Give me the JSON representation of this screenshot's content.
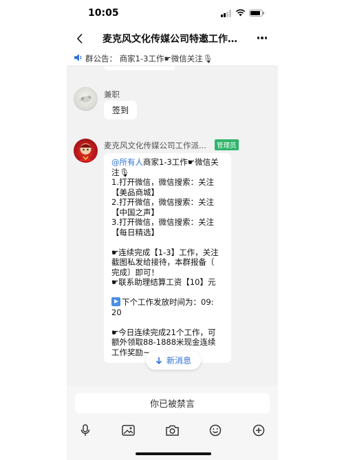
{
  "status_bar": {
    "time": "10:05",
    "battery_level": 0.9
  },
  "header": {
    "title": "麦克风文化传媒公司特邀工作...",
    "back_icon": "chevron-left-icon",
    "more_icon": "more-dots-icon"
  },
  "notice": {
    "label": "群公告：",
    "text": "商家1-3工作☛微信关注🎙",
    "icon": "megaphone-icon"
  },
  "messages": [
    {
      "sender": "兼职",
      "text": "签到"
    },
    {
      "sender": "麦克风文化传媒公司工作派...",
      "badge": "管理员",
      "mention": "@所有人",
      "lines": [
        "商家1-3工作☛微信关",
        "注🎙",
        "1.打开微信，微信搜索：关注",
        "【美品商城】",
        "2.打开微信，微信搜索：关注",
        "【中国之声】",
        "3.打开微信，微信搜索：关注",
        "【每日精选】",
        "",
        "☛连续完成【1-3】工作，关注",
        "截图私发给接待，本群报备〔",
        "完成〕即可！",
        "☛联系助理结算工资【10】元",
        "",
        "下个工作发放时间为：09:",
        "20",
        "",
        "☛今日连续完成21个工作，可",
        "额外领取88-1888米现金连续",
        "工作奖励~~"
      ]
    }
  ],
  "new_messages_label": "新消息",
  "muted_text": "你已被禁言",
  "toolbar_icons": [
    "microphone-icon",
    "image-icon",
    "camera-icon",
    "emoji-icon",
    "plus-icon"
  ],
  "colors": {
    "accent": "#2f72d6",
    "badge": "#2fb46b"
  }
}
